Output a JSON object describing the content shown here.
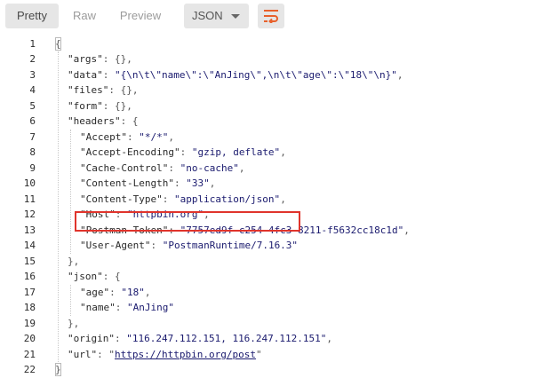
{
  "toolbar": {
    "tabs": [
      "Pretty",
      "Raw",
      "Preview"
    ],
    "format": "JSON",
    "wrap_icon": "wrap-lines-icon",
    "accent_color": "#e8612c"
  },
  "lines": [
    {
      "n": "1",
      "parts": [
        {
          "t": "p",
          "v": "{"
        }
      ]
    },
    {
      "n": "2",
      "parts": [
        {
          "t": "k",
          "v": "\"args\""
        },
        {
          "t": "p",
          "v": ": {},"
        }
      ]
    },
    {
      "n": "3",
      "parts": [
        {
          "t": "k",
          "v": "\"data\""
        },
        {
          "t": "p",
          "v": ": "
        },
        {
          "t": "s",
          "v": "\"{\\n\\t\\\"name\\\":\\\"AnJing\\\",\\n\\t\\\"age\\\":\\\"18\\\"\\n}\""
        },
        {
          "t": "p",
          "v": ","
        }
      ]
    },
    {
      "n": "4",
      "parts": [
        {
          "t": "k",
          "v": "\"files\""
        },
        {
          "t": "p",
          "v": ": {},"
        }
      ]
    },
    {
      "n": "5",
      "parts": [
        {
          "t": "k",
          "v": "\"form\""
        },
        {
          "t": "p",
          "v": ": {},"
        }
      ]
    },
    {
      "n": "6",
      "parts": [
        {
          "t": "k",
          "v": "\"headers\""
        },
        {
          "t": "p",
          "v": ": {"
        }
      ]
    },
    {
      "n": "7",
      "parts": [
        {
          "t": "k",
          "v": "\"Accept\""
        },
        {
          "t": "p",
          "v": ": "
        },
        {
          "t": "s",
          "v": "\"*/*\""
        },
        {
          "t": "p",
          "v": ","
        }
      ]
    },
    {
      "n": "8",
      "parts": [
        {
          "t": "k",
          "v": "\"Accept-Encoding\""
        },
        {
          "t": "p",
          "v": ": "
        },
        {
          "t": "s",
          "v": "\"gzip, deflate\""
        },
        {
          "t": "p",
          "v": ","
        }
      ]
    },
    {
      "n": "9",
      "parts": [
        {
          "t": "k",
          "v": "\"Cache-Control\""
        },
        {
          "t": "p",
          "v": ": "
        },
        {
          "t": "s",
          "v": "\"no-cache\""
        },
        {
          "t": "p",
          "v": ","
        }
      ]
    },
    {
      "n": "10",
      "parts": [
        {
          "t": "k",
          "v": "\"Content-Length\""
        },
        {
          "t": "p",
          "v": ": "
        },
        {
          "t": "s",
          "v": "\"33\""
        },
        {
          "t": "p",
          "v": ","
        }
      ]
    },
    {
      "n": "11",
      "parts": [
        {
          "t": "k",
          "v": "\"Content-Type\""
        },
        {
          "t": "p",
          "v": ": "
        },
        {
          "t": "s",
          "v": "\"application/json\""
        },
        {
          "t": "p",
          "v": ","
        }
      ]
    },
    {
      "n": "12",
      "parts": [
        {
          "t": "k",
          "v": "\"Host\""
        },
        {
          "t": "p",
          "v": ": "
        },
        {
          "t": "s",
          "v": "\"httpbin.org\""
        },
        {
          "t": "p",
          "v": ","
        }
      ]
    },
    {
      "n": "13",
      "parts": [
        {
          "t": "k",
          "v": "\"Postman-Token\""
        },
        {
          "t": "p",
          "v": ": "
        },
        {
          "t": "s",
          "v": "\"7757ed9f-c254-4fc3-8211-f5632cc18c1d\""
        },
        {
          "t": "p",
          "v": ","
        }
      ]
    },
    {
      "n": "14",
      "parts": [
        {
          "t": "k",
          "v": "\"User-Agent\""
        },
        {
          "t": "p",
          "v": ": "
        },
        {
          "t": "s",
          "v": "\"PostmanRuntime/7.16.3\""
        }
      ]
    },
    {
      "n": "15",
      "parts": [
        {
          "t": "p",
          "v": "},"
        }
      ]
    },
    {
      "n": "16",
      "parts": [
        {
          "t": "k",
          "v": "\"json\""
        },
        {
          "t": "p",
          "v": ": {"
        }
      ]
    },
    {
      "n": "17",
      "parts": [
        {
          "t": "k",
          "v": "\"age\""
        },
        {
          "t": "p",
          "v": ": "
        },
        {
          "t": "s",
          "v": "\"18\""
        },
        {
          "t": "p",
          "v": ","
        }
      ]
    },
    {
      "n": "18",
      "parts": [
        {
          "t": "k",
          "v": "\"name\""
        },
        {
          "t": "p",
          "v": ": "
        },
        {
          "t": "s",
          "v": "\"AnJing\""
        }
      ]
    },
    {
      "n": "19",
      "parts": [
        {
          "t": "p",
          "v": "},"
        }
      ]
    },
    {
      "n": "20",
      "parts": [
        {
          "t": "k",
          "v": "\"origin\""
        },
        {
          "t": "p",
          "v": ": "
        },
        {
          "t": "s",
          "v": "\"116.247.112.151, 116.247.112.151\""
        },
        {
          "t": "p",
          "v": ","
        }
      ]
    },
    {
      "n": "21",
      "parts": [
        {
          "t": "k",
          "v": "\"url\""
        },
        {
          "t": "p",
          "v": ": "
        },
        {
          "t": "p",
          "v": "\""
        },
        {
          "t": "url",
          "v": "https://httpbin.org/post"
        },
        {
          "t": "p",
          "v": "\""
        }
      ]
    },
    {
      "n": "22",
      "parts": [
        {
          "t": "p",
          "v": "}"
        }
      ]
    }
  ],
  "highlight": {
    "line": "11",
    "color": "#e0342c"
  }
}
